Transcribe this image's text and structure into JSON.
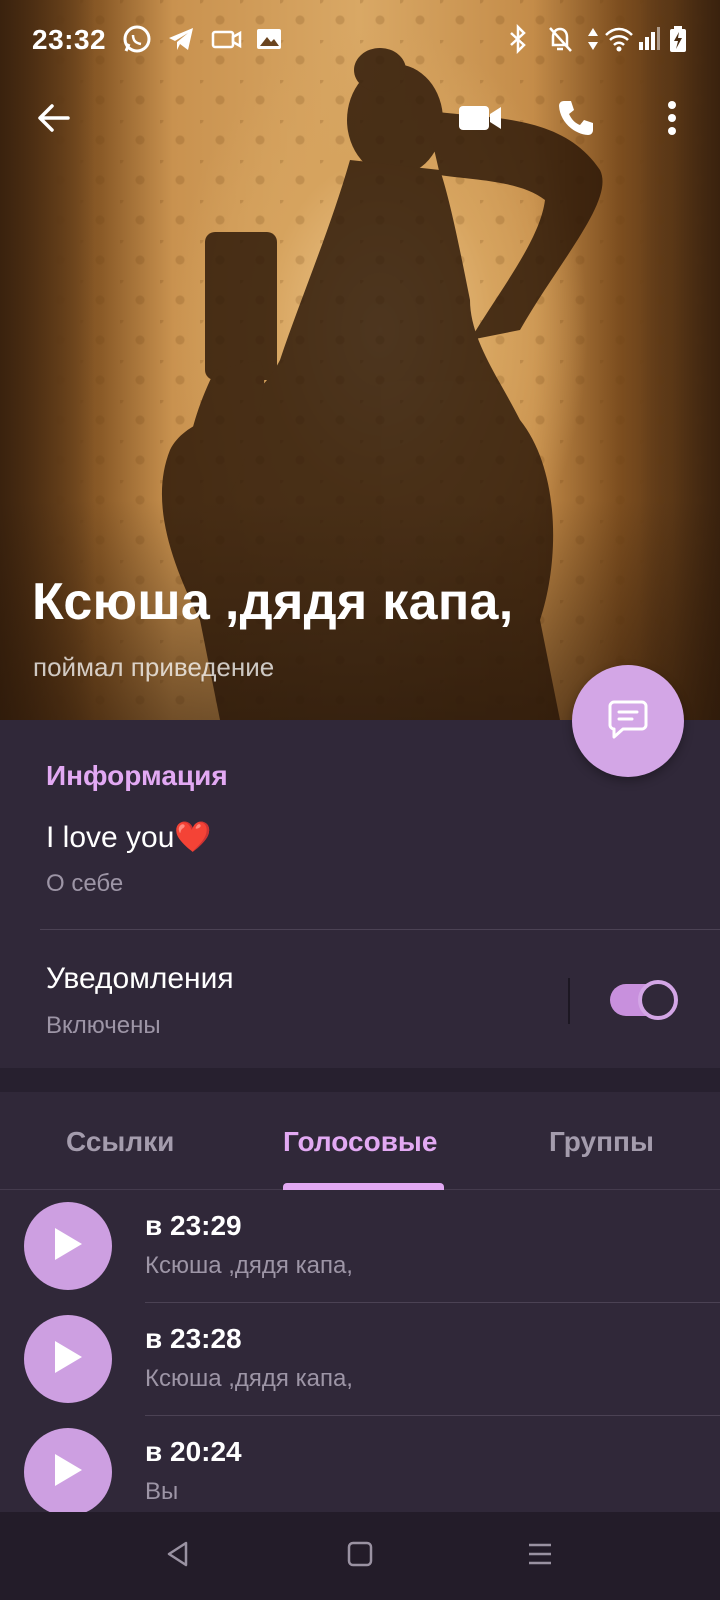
{
  "status_bar": {
    "time": "23:32",
    "left_icons": [
      "whatsapp-icon",
      "telegram-icon",
      "video-recording-icon",
      "image-notification-icon"
    ],
    "right_icons": [
      "bluetooth-icon",
      "mute-bell-icon",
      "data-arrows-icon",
      "wifi-icon",
      "signal-icon",
      "battery-charging-icon"
    ]
  },
  "toolbar": {
    "back_icon": "arrow-left-icon",
    "video_call_icon": "video-camera-icon",
    "call_icon": "phone-icon",
    "menu_icon": "more-vertical-icon"
  },
  "profile": {
    "name": "Ксюша ,дядя капа,",
    "status": "поймал приведение",
    "fab_icon": "message-icon"
  },
  "info": {
    "title": "Информация",
    "bio_text": "I love you",
    "bio_emoji": "❤️",
    "bio_label": "О себе",
    "notifications_label": "Уведомления",
    "notifications_status": "Включены",
    "notifications_enabled": true
  },
  "tabs": [
    {
      "label": "Ссылки",
      "active": false
    },
    {
      "label": "Голосовые",
      "active": true
    },
    {
      "label": "Группы",
      "active": false
    }
  ],
  "voice_messages": [
    {
      "time": "в 23:29",
      "from": "Ксюша ,дядя капа,"
    },
    {
      "time": "в 23:28",
      "from": "Ксюша ,дядя капа,"
    },
    {
      "time": "в 20:24",
      "from": "Вы"
    }
  ],
  "nav_bar": {
    "back_icon": "triangle-back-icon",
    "home_icon": "square-home-icon",
    "recents_icon": "menu-lines-icon"
  },
  "colors": {
    "accent": "#e2a9f3",
    "fab": "#d3a6e6",
    "card_bg": "#302839",
    "nav_bg": "#231c29"
  }
}
